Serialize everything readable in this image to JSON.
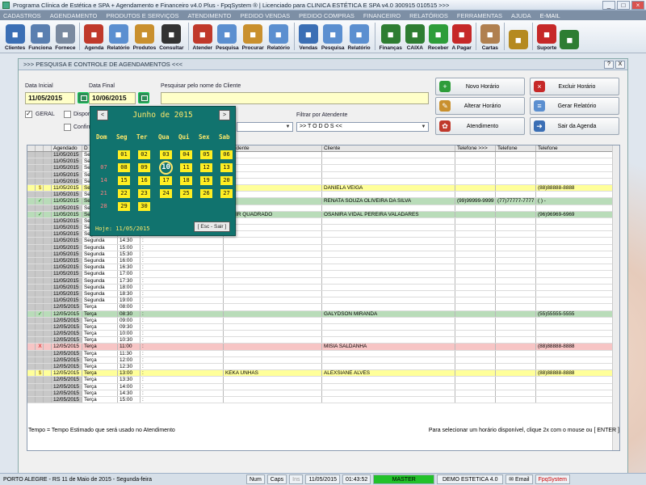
{
  "window": {
    "title": "Programa Clínica de Estética e SPA + Agendamento e Financeiro v4.0 Plus - FpqSystem ® | Licenciado para  CLINICA ESTÉTICA E SPA v4.0 300915 010515 >>>"
  },
  "menu": [
    "CADASTROS",
    "AGENDAMENTO",
    "PRODUTOS E SERVIÇOS",
    "ATENDIMENTO",
    "PEDIDO VENDAS",
    "PEDIDO COMPRAS",
    "FINANCEIRO",
    "RELATÓRIOS",
    "FERRAMENTAS",
    "AJUDA",
    "E-MAIL"
  ],
  "toolbar": [
    {
      "label": "Clientes",
      "icon": "clients-icon",
      "color": "#3b6fb5"
    },
    {
      "label": "Funciona",
      "icon": "employees-icon",
      "color": "#5a7fb0"
    },
    {
      "label": "Fornece",
      "icon": "suppliers-icon",
      "color": "#7a8aa0"
    },
    {
      "label": "Agenda",
      "icon": "agenda-icon",
      "color": "#c0392b"
    },
    {
      "label": "Relatório",
      "icon": "report-icon",
      "color": "#5b8fd0"
    },
    {
      "label": "Produtos",
      "icon": "boxes-icon",
      "color": "#c9902e"
    },
    {
      "label": "Consultar",
      "icon": "consult-icon",
      "color": "#333"
    },
    {
      "label": "Atender",
      "icon": "attend-icon",
      "color": "#c0392b"
    },
    {
      "label": "Pesquisa",
      "icon": "search-icon",
      "color": "#5b8fd0"
    },
    {
      "label": "Procurar",
      "icon": "find-icon",
      "color": "#c9902e"
    },
    {
      "label": "Relatório",
      "icon": "report-icon",
      "color": "#5b8fd0"
    },
    {
      "label": "Vendas",
      "icon": "sales-icon",
      "color": "#3b6fb5"
    },
    {
      "label": "Pesquisa",
      "icon": "search-icon",
      "color": "#5b8fd0"
    },
    {
      "label": "Relatório",
      "icon": "report-icon",
      "color": "#5b8fd0"
    },
    {
      "label": "Finanças",
      "icon": "finance-icon",
      "color": "#2e7d32"
    },
    {
      "label": "CAIXA",
      "icon": "cash-icon",
      "color": "#2e7d32"
    },
    {
      "label": "Receber",
      "icon": "receive-icon",
      "color": "#2e9d3a"
    },
    {
      "label": "A Pagar",
      "icon": "pay-icon",
      "color": "#c62828"
    },
    {
      "label": "Cartas",
      "icon": "letters-icon",
      "color": "#b08050"
    },
    {
      "label": "",
      "icon": "coins-icon",
      "color": "#b58a20"
    },
    {
      "label": "Suporte",
      "icon": "support-icon",
      "color": "#c62828"
    },
    {
      "label": "",
      "icon": "exit-icon",
      "color": "#2e7d32"
    }
  ],
  "panel": {
    "title": ">>>  PESQUISA E CONTROLE DE AGENDAMENTOS  <<<",
    "help": "?",
    "close": "X"
  },
  "filters": {
    "date_start_label": "Data Inicial",
    "date_start": "11/05/2015",
    "date_end_label": "Data Final",
    "date_end": "10/06/2015",
    "client_search_label": "Pesquisar pelo nome do Cliente",
    "geral_label": "GERAL",
    "disp_label": "Dispon",
    "conf_label": "Confirm",
    "atendente_label": "Filtrar por Atendente",
    "atendente_value": ">> T O D O S <<"
  },
  "buttons": {
    "novo": "Novo Horário",
    "excluir": "Excluir Horário",
    "alterar": "Alterar Horário",
    "relatorio": "Gerar Relatório",
    "atendimento": "Atendimento",
    "sair": "Sair da Agenda"
  },
  "grid": {
    "headers": [
      "",
      "",
      "",
      "Agendado",
      "D",
      "",
      "",
      "Atendente",
      "Cliente",
      "Telefone  >>>",
      "Telefone",
      "Telefone"
    ],
    "rows": [
      {
        "st": "",
        "d": "11/05/2015",
        "w": "Se",
        "h": "",
        "a": "",
        "c": "",
        "t1": "",
        "t2": "",
        "t3": "",
        "cls": "ind"
      },
      {
        "st": "",
        "d": "11/05/2015",
        "w": "Se",
        "h": "",
        "a": "",
        "c": "",
        "t1": "",
        "t2": "",
        "t3": "",
        "cls": "ind"
      },
      {
        "st": "",
        "d": "11/05/2015",
        "w": "Se",
        "h": "",
        "a": "",
        "c": "",
        "t1": "",
        "t2": "",
        "t3": "",
        "cls": "ind"
      },
      {
        "st": "",
        "d": "11/05/2015",
        "w": "Se",
        "h": "",
        "a": "",
        "c": "",
        "t1": "",
        "t2": "",
        "t3": "",
        "cls": "ind"
      },
      {
        "st": "",
        "d": "11/05/2015",
        "w": "Se",
        "h": "",
        "a": "",
        "c": "",
        "t1": "",
        "t2": "",
        "t3": "",
        "cls": "ind"
      },
      {
        "st": "$",
        "d": "11/05/2015",
        "w": "Se",
        "h": "",
        "a": "",
        "c": "DANIELA VEIGA",
        "t1": "",
        "t2": "",
        "t3": "(88)88888-8888",
        "cls": "y"
      },
      {
        "st": "",
        "d": "11/05/2015",
        "w": "Se",
        "h": "",
        "a": "",
        "c": "",
        "t1": "",
        "t2": "",
        "t3": "",
        "cls": "ind"
      },
      {
        "st": "✓",
        "d": "11/05/2015",
        "w": "Se",
        "h": "",
        "a": "",
        "c": "RENATA SOUZA OLIVEIRA DA SILVA",
        "t1": "(99)99999-9999",
        "t2": "(77)77777-7777",
        "t3": "(  )    -",
        "cls": "g"
      },
      {
        "st": "",
        "d": "11/05/2015",
        "w": "Se",
        "h": "",
        "a": "",
        "c": "",
        "t1": "",
        "t2": "",
        "t3": "",
        "cls": "ind"
      },
      {
        "st": "✓",
        "d": "11/05/2015",
        "w": "Se",
        "h": "",
        "a": "ANAIR QUADRADO",
        "c": "OSANIRA VIDAL PEREIRA VALADARES",
        "t1": "",
        "t2": "",
        "t3": "(96)96969-6969",
        "cls": "g"
      },
      {
        "st": "",
        "d": "11/05/2015",
        "w": "Se",
        "h": "",
        "a": "",
        "c": "",
        "t1": "",
        "t2": "",
        "t3": "",
        "cls": "ind"
      },
      {
        "st": "",
        "d": "11/05/2015",
        "w": "Se",
        "h": "",
        "a": "",
        "c": "",
        "t1": "",
        "t2": "",
        "t3": "",
        "cls": "ind"
      },
      {
        "st": "",
        "d": "11/05/2015",
        "w": "Segunda",
        "h": "14:00",
        "a": "",
        "c": "",
        "t1": "",
        "t2": "",
        "t3": "",
        "cls": "ind"
      },
      {
        "st": "",
        "d": "11/05/2015",
        "w": "Segunda",
        "h": "14:30",
        "a": "",
        "c": "",
        "t1": "",
        "t2": "",
        "t3": "",
        "cls": "ind"
      },
      {
        "st": "",
        "d": "11/05/2015",
        "w": "Segunda",
        "h": "15:00",
        "a": "",
        "c": "",
        "t1": "",
        "t2": "",
        "t3": "",
        "cls": "ind"
      },
      {
        "st": "",
        "d": "11/05/2015",
        "w": "Segunda",
        "h": "15:30",
        "a": "",
        "c": "",
        "t1": "",
        "t2": "",
        "t3": "",
        "cls": "ind"
      },
      {
        "st": "",
        "d": "11/05/2015",
        "w": "Segunda",
        "h": "16:00",
        "a": "",
        "c": "",
        "t1": "",
        "t2": "",
        "t3": "",
        "cls": "ind"
      },
      {
        "st": "",
        "d": "11/05/2015",
        "w": "Segunda",
        "h": "16:30",
        "a": "",
        "c": "",
        "t1": "",
        "t2": "",
        "t3": "",
        "cls": "ind"
      },
      {
        "st": "",
        "d": "11/05/2015",
        "w": "Segunda",
        "h": "17:00",
        "a": "",
        "c": "",
        "t1": "",
        "t2": "",
        "t3": "",
        "cls": "ind"
      },
      {
        "st": "",
        "d": "11/05/2015",
        "w": "Segunda",
        "h": "17:30",
        "a": "",
        "c": "",
        "t1": "",
        "t2": "",
        "t3": "",
        "cls": "ind"
      },
      {
        "st": "",
        "d": "11/05/2015",
        "w": "Segunda",
        "h": "18:00",
        "a": "",
        "c": "",
        "t1": "",
        "t2": "",
        "t3": "",
        "cls": "ind"
      },
      {
        "st": "",
        "d": "11/05/2015",
        "w": "Segunda",
        "h": "18:30",
        "a": "",
        "c": "",
        "t1": "",
        "t2": "",
        "t3": "",
        "cls": "ind"
      },
      {
        "st": "",
        "d": "11/05/2015",
        "w": "Segunda",
        "h": "19:00",
        "a": "",
        "c": "",
        "t1": "",
        "t2": "",
        "t3": "",
        "cls": "ind"
      },
      {
        "st": "",
        "d": "12/05/2015",
        "w": "Terça",
        "h": "08:00",
        "a": "",
        "c": "",
        "t1": "",
        "t2": "",
        "t3": "",
        "cls": "ind"
      },
      {
        "st": "✓",
        "d": "12/05/2015",
        "w": "Terça",
        "h": "08:30",
        "a": "",
        "c": "GALYDSON MIRANDA",
        "t1": "",
        "t2": "",
        "t3": "(55)55555-5555",
        "cls": "g"
      },
      {
        "st": "",
        "d": "12/05/2015",
        "w": "Terça",
        "h": "09:00",
        "a": "",
        "c": "",
        "t1": "",
        "t2": "",
        "t3": "",
        "cls": "ind"
      },
      {
        "st": "",
        "d": "12/05/2015",
        "w": "Terça",
        "h": "09:30",
        "a": "",
        "c": "",
        "t1": "",
        "t2": "",
        "t3": "",
        "cls": "ind"
      },
      {
        "st": "",
        "d": "12/05/2015",
        "w": "Terça",
        "h": "10:00",
        "a": "",
        "c": "",
        "t1": "",
        "t2": "",
        "t3": "",
        "cls": "ind"
      },
      {
        "st": "",
        "d": "12/05/2015",
        "w": "Terça",
        "h": "10:30",
        "a": "",
        "c": "",
        "t1": "",
        "t2": "",
        "t3": "",
        "cls": "ind"
      },
      {
        "st": "X",
        "d": "12/05/2015",
        "w": "Terça",
        "h": "11:00",
        "a": "",
        "c": "MISIA SALDANHA",
        "t1": "",
        "t2": "",
        "t3": "(88)88888-8888",
        "cls": "r"
      },
      {
        "st": "",
        "d": "12/05/2015",
        "w": "Terça",
        "h": "11:30",
        "a": "",
        "c": "",
        "t1": "",
        "t2": "",
        "t3": "",
        "cls": "ind"
      },
      {
        "st": "",
        "d": "12/05/2015",
        "w": "Terça",
        "h": "12:00",
        "a": "",
        "c": "",
        "t1": "",
        "t2": "",
        "t3": "",
        "cls": "ind"
      },
      {
        "st": "",
        "d": "12/05/2015",
        "w": "Terça",
        "h": "12:30",
        "a": "",
        "c": "",
        "t1": "",
        "t2": "",
        "t3": "",
        "cls": "ind"
      },
      {
        "st": "$",
        "d": "12/05/2015",
        "w": "Terça",
        "h": "13:00",
        "a": "KEKA UNHAS",
        "c": "ALEXSIANE ALVES",
        "t1": "",
        "t2": "",
        "t3": "(88)88888-8888",
        "cls": "y"
      },
      {
        "st": "",
        "d": "12/05/2015",
        "w": "Terça",
        "h": "13:30",
        "a": "",
        "c": "",
        "t1": "",
        "t2": "",
        "t3": "",
        "cls": "ind"
      },
      {
        "st": "",
        "d": "12/05/2015",
        "w": "Terça",
        "h": "14:00",
        "a": "",
        "c": "",
        "t1": "",
        "t2": "",
        "t3": "",
        "cls": "ind"
      },
      {
        "st": "",
        "d": "12/05/2015",
        "w": "Terça",
        "h": "14:30",
        "a": "",
        "c": "",
        "t1": "",
        "t2": "",
        "t3": "",
        "cls": "ind"
      },
      {
        "st": "",
        "d": "12/05/2015",
        "w": "Terça",
        "h": "15:00",
        "a": "",
        "c": "",
        "t1": "",
        "t2": "",
        "t3": "",
        "cls": "ind"
      }
    ]
  },
  "hints": {
    "left": "Tempo = Tempo Estimado que será usado no Atendimento",
    "right": "Para selecionar um horário disponível, clique 2x com o mouse ou [ ENTER ]"
  },
  "calendar": {
    "month_title": "Junho de 2015",
    "prev": "<",
    "next": ">",
    "weekdays": [
      "Dom",
      "Seg",
      "Ter",
      "Qua",
      "Qui",
      "Sex",
      "Sab"
    ],
    "weeks": [
      [
        "",
        "01",
        "02",
        "03",
        "04",
        "05",
        "06"
      ],
      [
        "07",
        "08",
        "09",
        "10",
        "11",
        "12",
        "13"
      ],
      [
        "14",
        "15",
        "16",
        "17",
        "18",
        "19",
        "20"
      ],
      [
        "21",
        "22",
        "23",
        "24",
        "25",
        "26",
        "27"
      ],
      [
        "28",
        "29",
        "30",
        "",
        "",
        "",
        ""
      ]
    ],
    "today_label": "Hoje: 11/05/2015",
    "esc_label": "[ Esc - Sair ]",
    "selected": "10"
  },
  "status": {
    "location": "PORTO ALEGRE - RS 11 de Maio de 2015 - Segunda-feira",
    "num": "Num",
    "caps": "Caps",
    "ins": "Ins",
    "date": "11/05/2015",
    "time": "01:43:52",
    "user": "MASTER",
    "company": "DEMO ESTETICA 4.0",
    "email": "Email",
    "brand": "FpqSystem"
  }
}
